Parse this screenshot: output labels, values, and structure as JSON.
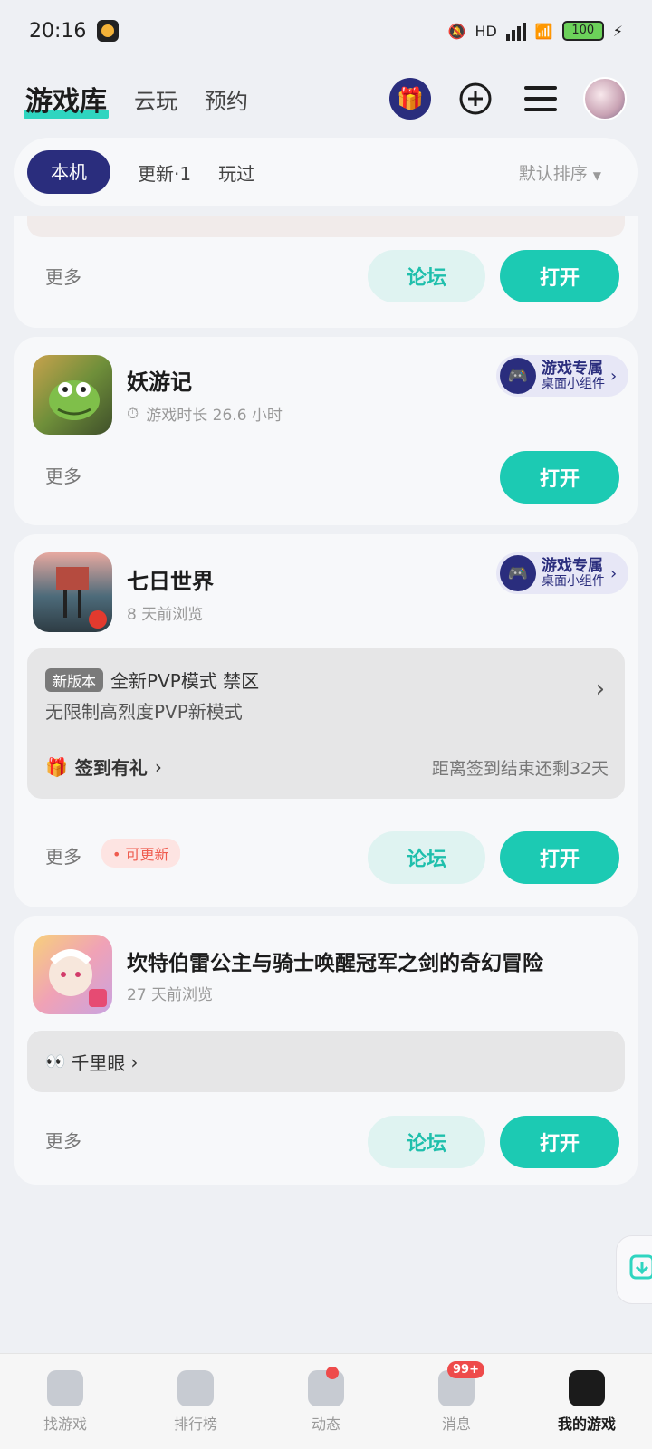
{
  "status_bar": {
    "time": "20:16",
    "battery": "100",
    "network": "HD"
  },
  "header": {
    "tabs": [
      "游戏库",
      "云玩",
      "预约"
    ],
    "icons": [
      "gift-icon",
      "add-icon",
      "menu-icon",
      "avatar"
    ]
  },
  "filter": {
    "chips": [
      "本机",
      "更新·1",
      "玩过"
    ],
    "sort_label": "默认排序"
  },
  "top_card": {
    "more": "更多",
    "forum": "论坛",
    "open": "打开"
  },
  "games": [
    {
      "title": "妖游记",
      "meta": "游戏时长 26.6 小时",
      "widget_title": "游戏专属",
      "widget_sub": "桌面小组件",
      "more": "更多",
      "open": "打开"
    },
    {
      "title": "七日世界",
      "meta": "8 天前浏览",
      "widget_title": "游戏专属",
      "widget_sub": "桌面小组件",
      "news_tag": "新版本",
      "news_title": "全新PVP模式 禁区",
      "news_desc": "无限制高烈度PVP新模式",
      "sign_label": "签到有礼",
      "sign_remaining": "距离签到结束还剩32天",
      "more": "更多",
      "update_badge": "可更新",
      "forum": "论坛",
      "open": "打开"
    },
    {
      "title": "坎特伯雷公主与骑士唤醒冠军之剑的奇幻冒险",
      "meta": "27 天前浏览",
      "eye_label": "千里眼",
      "more": "更多",
      "forum": "论坛",
      "open": "打开"
    }
  ],
  "bottom_nav": [
    {
      "label": "找游戏"
    },
    {
      "label": "排行榜"
    },
    {
      "label": "动态"
    },
    {
      "label": "消息",
      "badge": "99+"
    },
    {
      "label": "我的游戏"
    }
  ],
  "colors": {
    "accent": "#1ccab3",
    "brand": "#2a2d7d",
    "alert": "#ee4b4b"
  }
}
